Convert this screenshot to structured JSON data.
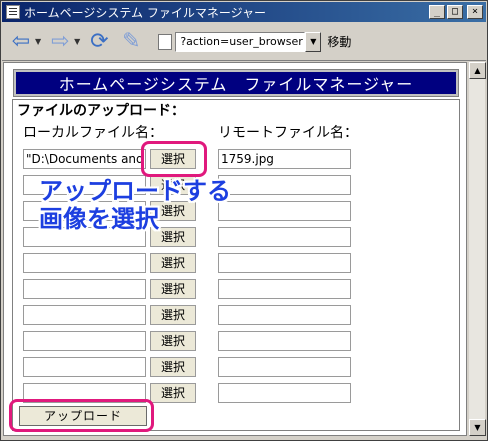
{
  "window": {
    "title": "ホームページシステム ファイルマネージャー"
  },
  "toolbar": {
    "address": "?action=user_browser",
    "go_label": "移動"
  },
  "page": {
    "banner": "ホームページシステム　ファイルマネージャー",
    "section_title": "ファイルのアップロード：",
    "local_label": "ローカルファイル名：",
    "remote_label": "リモートファイル名：",
    "select_label": "選択",
    "upload_label": "アップロード",
    "rows": [
      {
        "local": "\"D:\\Documents and",
        "remote": "1759.jpg"
      },
      {
        "local": "",
        "remote": ""
      },
      {
        "local": "",
        "remote": ""
      },
      {
        "local": "",
        "remote": ""
      },
      {
        "local": "",
        "remote": ""
      },
      {
        "local": "",
        "remote": ""
      },
      {
        "local": "",
        "remote": ""
      },
      {
        "local": "",
        "remote": ""
      },
      {
        "local": "",
        "remote": ""
      },
      {
        "local": "",
        "remote": ""
      }
    ]
  },
  "annotation": {
    "line1": "アップロードする",
    "line2": "画像を選択",
    "color": "#1d3fe0",
    "highlight_color": "#e0197d"
  },
  "icons": [
    "back-icon",
    "forward-icon",
    "refresh-icon",
    "edit-icon",
    "page-icon"
  ]
}
